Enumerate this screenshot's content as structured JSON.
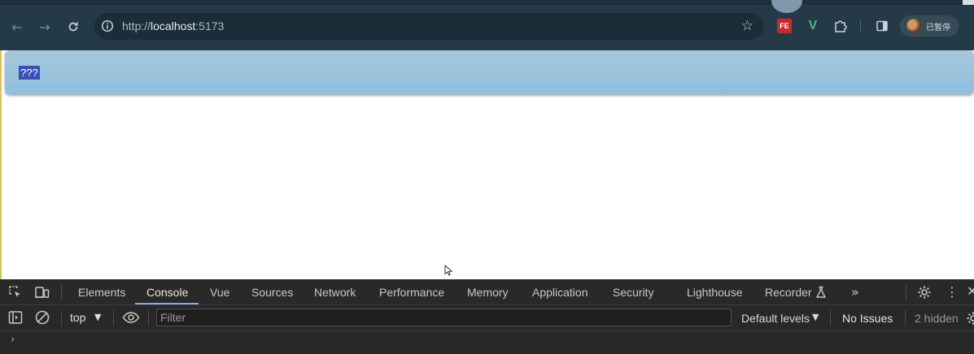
{
  "browser": {
    "url_scheme": "http://",
    "url_host": "localhost",
    "url_port": ":5173",
    "extensions": {
      "fe_label": "FE",
      "v_label": "V"
    },
    "profile_label": "已暂停"
  },
  "page": {
    "selected_text": "???"
  },
  "devtools": {
    "tabs": [
      {
        "label": "Elements"
      },
      {
        "label": "Console",
        "active": true
      },
      {
        "label": "Vue"
      },
      {
        "label": "Sources"
      },
      {
        "label": "Network"
      },
      {
        "label": "Performance"
      },
      {
        "label": "Memory"
      },
      {
        "label": "Application"
      },
      {
        "label": "Security"
      },
      {
        "label": "Lighthouse"
      },
      {
        "label": "Recorder"
      }
    ],
    "more_tabs": "»",
    "console": {
      "context": "top",
      "filter_placeholder": "Filter",
      "levels": "Default levels",
      "issues": "No Issues",
      "hidden": "2 hidden",
      "prompt": "›"
    }
  },
  "colors": {
    "toolbar_bg": "#243a47",
    "header_gradient_top": "#a9c7da",
    "header_gradient_bottom": "#8dbfe0",
    "selection": "#3a4fb5",
    "devtools_bg": "#282828",
    "accent": "#7cacf8"
  }
}
